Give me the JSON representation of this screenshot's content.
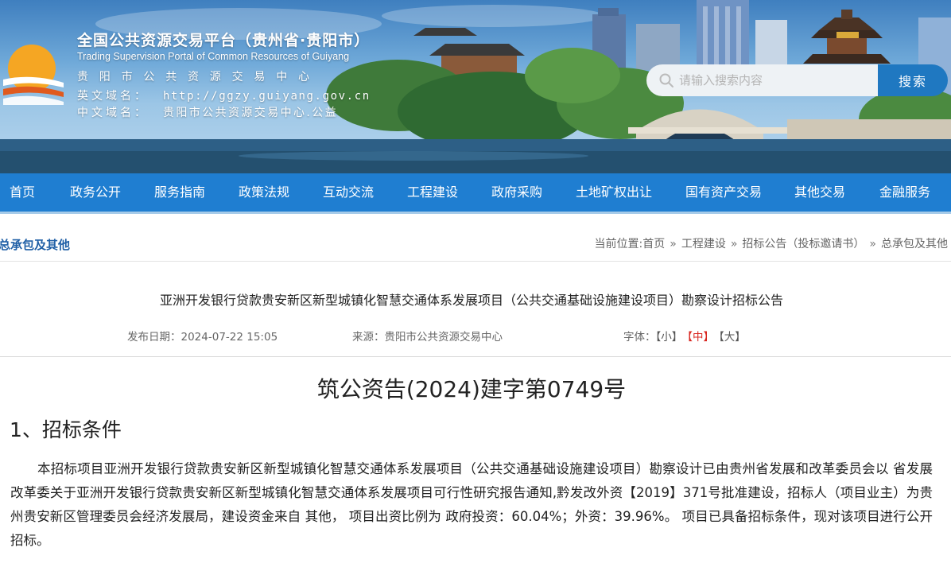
{
  "header": {
    "title": "全国公共资源交易平台（贵州省·贵阳市）",
    "subtitle_en": "Trading Supervision Portal of Common Resources of Guiyang",
    "center_name": "贵阳市公共资源交易中心",
    "domain_en_label": "英文域名：",
    "domain_en_value": "http://ggzy.guiyang.gov.cn",
    "domain_cn_label": "中文域名：",
    "domain_cn_value": "贵阳市公共资源交易中心.公益",
    "logo_icon": "sun-over-water-logo-icon",
    "building_sign": "甲秀楼"
  },
  "search": {
    "placeholder": "请输入搜索内容",
    "button_label": "搜索"
  },
  "nav": {
    "items": [
      "首页",
      "政务公开",
      "服务指南",
      "政策法规",
      "互动交流",
      "工程建设",
      "政府采购",
      "土地矿权出让",
      "国有资产交易",
      "其他交易",
      "金融服务"
    ]
  },
  "breadcrumb": {
    "section_title": "总承包及其他",
    "prefix": "当前位置:",
    "items": [
      "首页",
      "工程建设",
      "招标公告（投标邀请书）",
      "总承包及其他"
    ],
    "separator": "»"
  },
  "article": {
    "title": "亚洲开发银行贷款贵安新区新型城镇化智慧交通体系发展项目（公共交通基础设施建设项目）勘察设计招标公告",
    "publish_label": "发布日期：",
    "publish_date": "2024-07-22 15:05",
    "source_label": "来源：",
    "source": "贵阳市公共资源交易中心",
    "font_label": "字体：",
    "font_small": "【小】",
    "font_medium": "【中】",
    "font_large": "【大】",
    "doc_number": "筑公资告(2024)建字第0749号",
    "section1_heading": "1、招标条件",
    "section1_paragraph": "本招标项目亚洲开发银行贷款贵安新区新型城镇化智慧交通体系发展项目（公共交通基础设施建设项目）勘察设计已由贵州省发展和改革委员会以 省发展改革委关于亚洲开发银行贷款贵安新区新型城镇化智慧交通体系发展项目可行性研究报告通知,黔发改外资【2019】371号批准建设，招标人（项目业主）为贵州贵安新区管理委员会经济发展局，建设资金来自 其他， 项目出资比例为 政府投资：60.04%；外资：39.96%。 项目已具备招标条件，现对该项目进行公开招标。"
  },
  "colors": {
    "nav_blue": "#1f7ed1",
    "search_button": "#1f78c1",
    "section_title": "#1f5fa6",
    "active_font": "#d8261f"
  }
}
